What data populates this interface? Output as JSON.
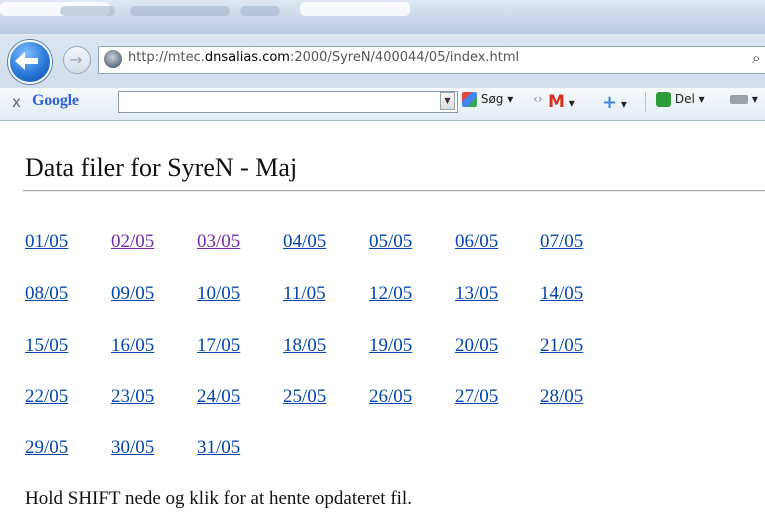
{
  "browser": {
    "url_prefix": "http://mtec.",
    "url_domain": "dnsalias.com",
    "url_suffix": ":2000/SyreN/400044/05/index.html",
    "icons": {
      "back": "back-arrow-icon",
      "forward": "forward-arrow-icon",
      "site": "site-globe-icon",
      "search": "search-icon"
    }
  },
  "google_toolbar": {
    "close_label": "x",
    "logo_text": "Google",
    "search_value": "",
    "search_button_label": "Søg",
    "share_label": "Del",
    "icons": [
      "search-go-icon",
      "gmail-icon",
      "plus-icon",
      "share-icon",
      "bookmark-icon"
    ]
  },
  "page": {
    "title": "Data filer for SyreN - Maj",
    "links": [
      "01/05",
      "02/05",
      "03/05",
      "04/05",
      "05/05",
      "06/05",
      "07/05",
      "08/05",
      "09/05",
      "10/05",
      "11/05",
      "12/05",
      "13/05",
      "14/05",
      "15/05",
      "16/05",
      "17/05",
      "18/05",
      "19/05",
      "20/05",
      "21/05",
      "22/05",
      "23/05",
      "24/05",
      "25/05",
      "26/05",
      "27/05",
      "28/05",
      "29/05",
      "30/05",
      "31/05"
    ],
    "visited": [
      "02/05",
      "03/05"
    ],
    "footer_text": "Hold SHIFT nede og klik for at hente opdateret fil."
  },
  "colors": {
    "link": "#0645ad",
    "visited_link": "#7a2aa6"
  }
}
